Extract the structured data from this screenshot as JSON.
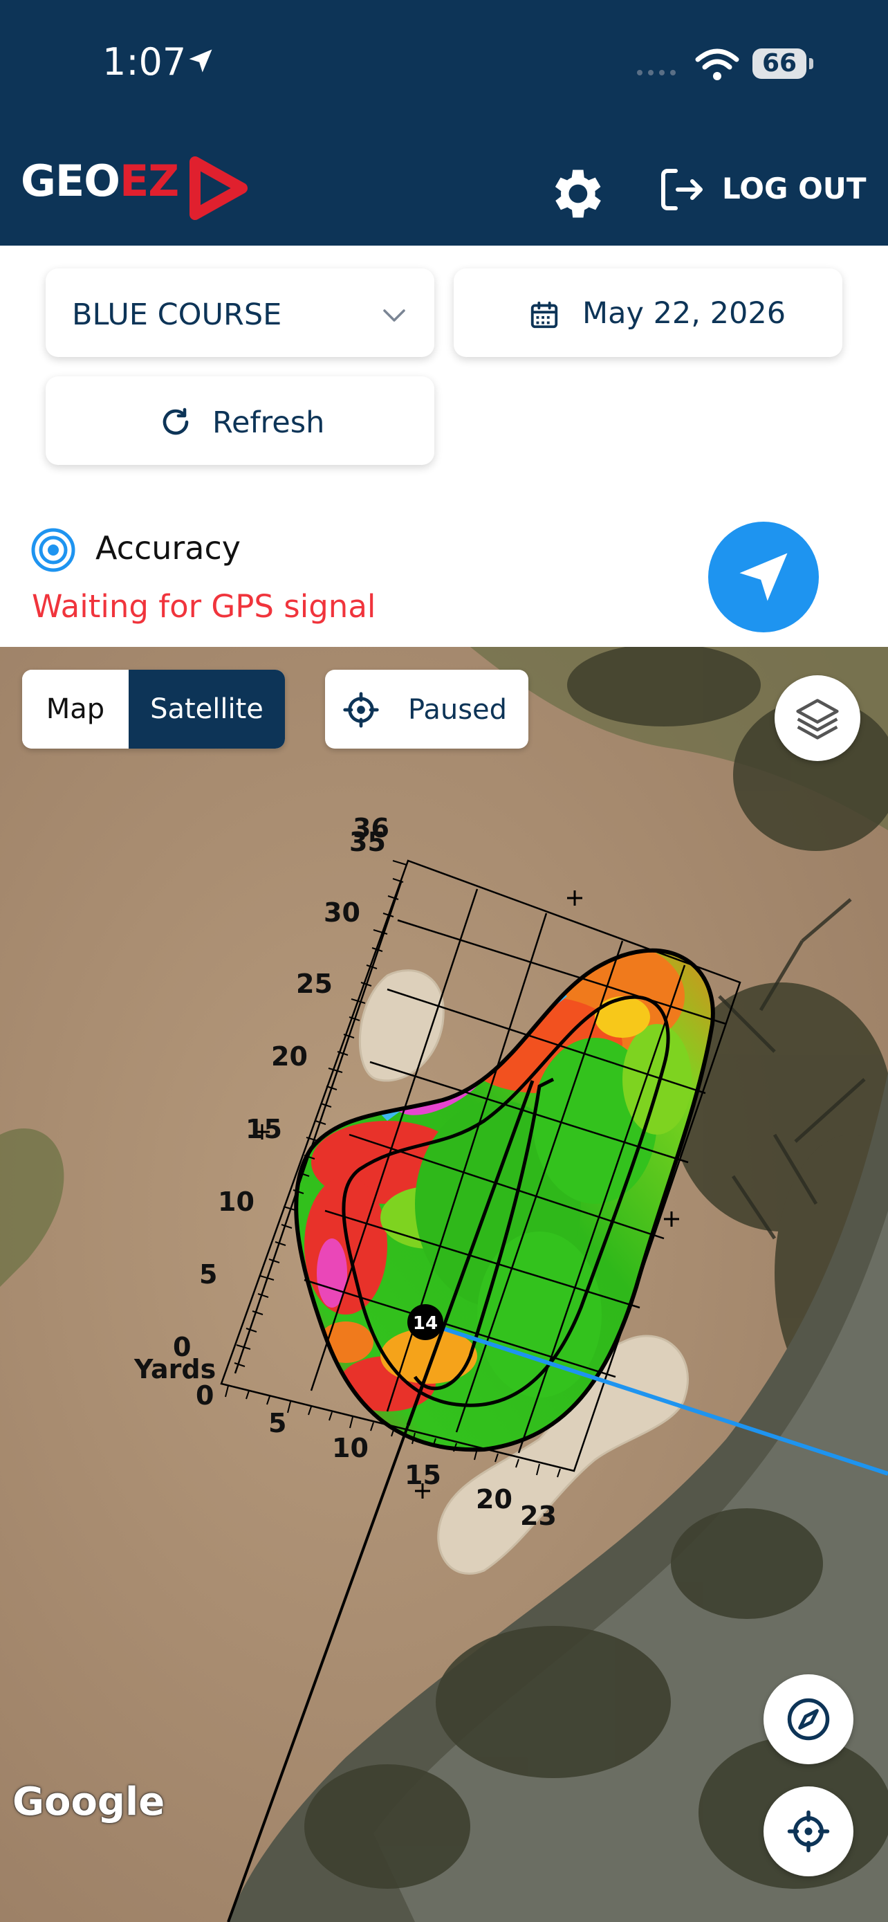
{
  "status_bar": {
    "time": "1:07",
    "battery": "66"
  },
  "header": {
    "logo_part1": "GEO",
    "logo_part2": "EZ",
    "logout_label": "LOG OUT"
  },
  "controls": {
    "course": "BLUE COURSE",
    "date": "May 22, 2026",
    "refresh_label": "Refresh"
  },
  "accuracy": {
    "label": "Accuracy",
    "status": "Waiting for GPS signal"
  },
  "map": {
    "view_toggle": {
      "options": [
        "Map",
        "Satellite"
      ],
      "selected": "Satellite"
    },
    "tracking_label": "Paused",
    "attribution": "Google",
    "hole_number": "14",
    "grid_left_labels": [
      "36",
      "35",
      "30",
      "25",
      "20",
      "15",
      "10",
      "5",
      "0"
    ],
    "grid_bottom_labels": [
      "0",
      "5",
      "10",
      "15",
      "20",
      "23"
    ],
    "grid_unit": "Yards"
  },
  "colors": {
    "navy": "#0d3457",
    "brand_red": "#e0202e",
    "alert_red": "#f0343c",
    "accent_blue": "#1e94f0"
  }
}
